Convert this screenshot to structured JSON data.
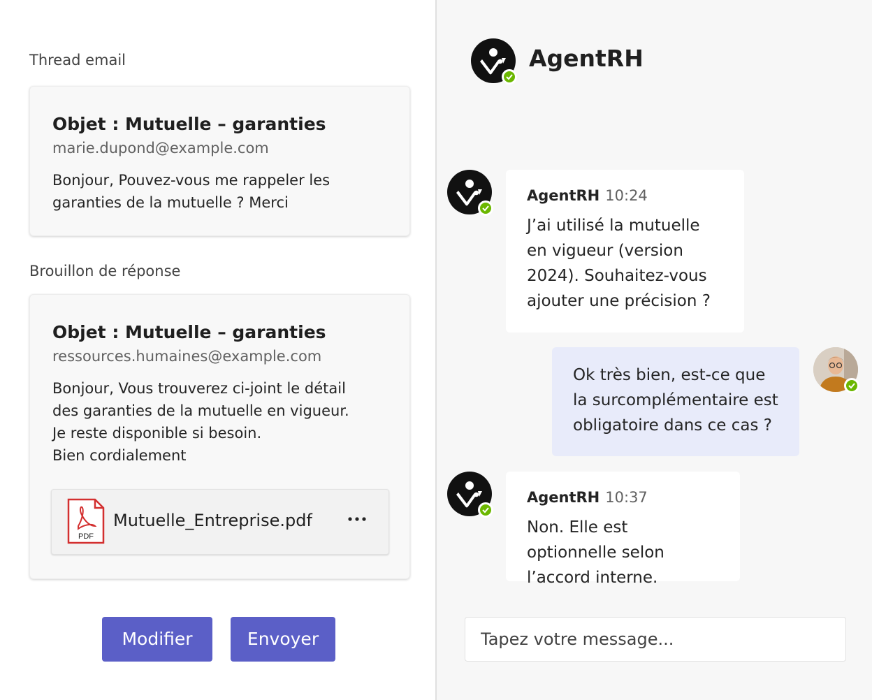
{
  "left": {
    "thread_label": "Thread email",
    "thread": {
      "subject": "Objet : Mutuelle – garanties",
      "from": "marie.dupond@example.com",
      "body": "Bonjour, Pouvez-vous me rappeler les garanties de la mutuelle ? Merci"
    },
    "draft_label": "Brouillon de réponse",
    "draft": {
      "subject": "Objet : Mutuelle – garanties",
      "from": "ressources.humaines@example.com",
      "body_lines": [
        "Bonjour, Vous trouverez ci-joint le détail",
        "des garanties de la mutuelle en vigueur.",
        "Je reste disponible si besoin.",
        "Bien cordialement"
      ],
      "attachment": {
        "name": "Mutuelle_Entreprise.pdf",
        "icon": "pdf-file-icon",
        "icon_label": "PDF",
        "more_icon": "more-options-icon"
      }
    },
    "buttons": {
      "modify": "Modifier",
      "send": "Envoyer"
    }
  },
  "chat": {
    "agent_name": "AgentRH",
    "status": "available",
    "messages": [
      {
        "author": "AgentRH",
        "time": "10:24",
        "text": "J’ai utilisé la mutuelle en vigueur (version 2024). Souhaitez-vous ajouter une précision ?",
        "from_me": false
      },
      {
        "author": "",
        "time": "",
        "text": "Ok très bien, est-ce que la surcomplémentaire est obligatoire dans ce cas ?",
        "from_me": true
      },
      {
        "author": "AgentRH",
        "time": "10:37",
        "text": "Non. Elle est optionnelle selon l’accord interne.",
        "from_me": false
      }
    ],
    "composer_placeholder": "Tapez votre message..."
  },
  "colors": {
    "accent": "#5b5fc7",
    "presence": "#6bb700",
    "my_bubble": "#e8ebfa",
    "pdf_red": "#d32f2f"
  }
}
